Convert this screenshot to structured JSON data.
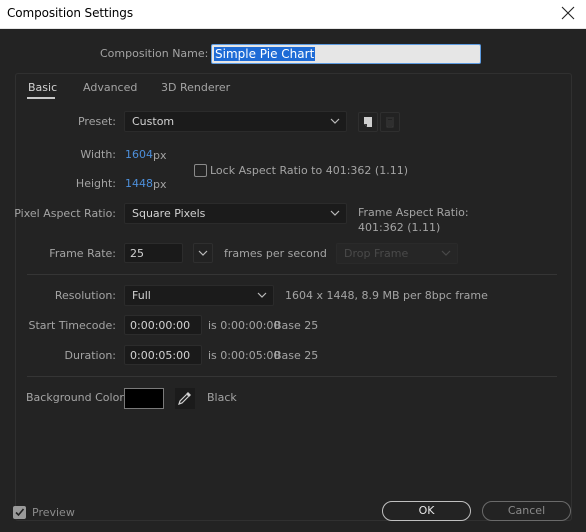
{
  "window": {
    "title": "Composition Settings",
    "close_icon": "close-icon"
  },
  "composition_name": {
    "label": "Composition Name:",
    "value": "Simple Pie Chart"
  },
  "tabs": [
    {
      "label": "Basic",
      "active": true
    },
    {
      "label": "Advanced",
      "active": false
    },
    {
      "label": "3D Renderer",
      "active": false
    }
  ],
  "basic": {
    "preset": {
      "label": "Preset:",
      "value": "Custom",
      "save_icon": "save-preset-icon",
      "delete_icon": "trash-icon"
    },
    "width": {
      "label": "Width:",
      "value": "1604",
      "unit": "px"
    },
    "height": {
      "label": "Height:",
      "value": "1448",
      "unit": "px"
    },
    "lock_aspect": {
      "label": "Lock Aspect Ratio to 401:362 (1.11)",
      "checked": false
    },
    "pixel_aspect": {
      "label": "Pixel Aspect Ratio:",
      "value": "Square Pixels"
    },
    "frame_aspect": {
      "label": "Frame Aspect Ratio:",
      "value": "401:362 (1.11)"
    },
    "frame_rate": {
      "label": "Frame Rate:",
      "value": "25",
      "unit": "frames per second",
      "drop_frame": "Drop Frame"
    },
    "resolution": {
      "label": "Resolution:",
      "value": "Full",
      "info": "1604 x 1448, 8.9 MB per 8bpc frame"
    },
    "start_timecode": {
      "label": "Start Timecode:",
      "value": "0:00:00:00",
      "info": "is 0:00:00:00",
      "base": "Base 25"
    },
    "duration": {
      "label": "Duration:",
      "value": "0:00:05:00",
      "info": "is 0:00:05:00",
      "base": "Base 25"
    },
    "background": {
      "label": "Background Color:",
      "color": "#000000",
      "name": "Black"
    }
  },
  "footer": {
    "preview_label": "Preview",
    "preview_checked": true,
    "ok_label": "OK",
    "cancel_label": "Cancel"
  }
}
